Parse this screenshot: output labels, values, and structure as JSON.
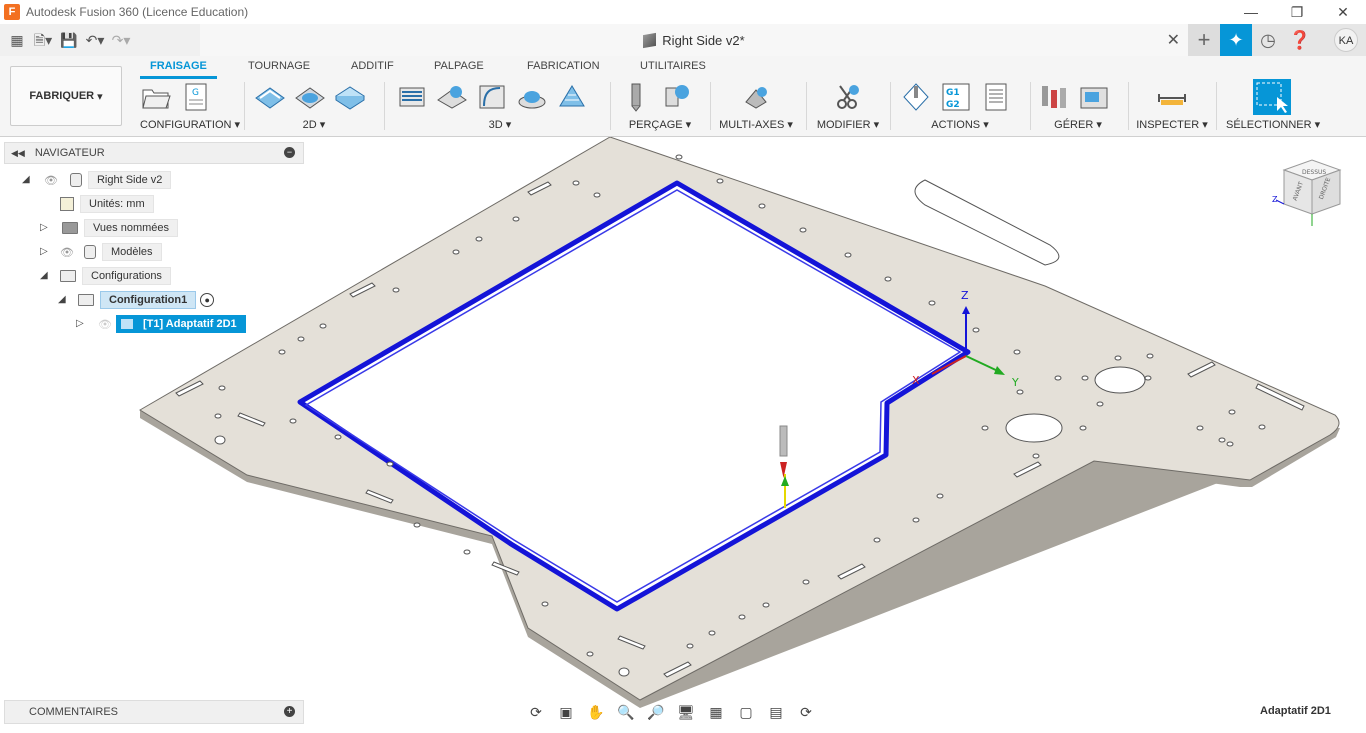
{
  "window": {
    "title": "Autodesk Fusion 360 (Licence Education)",
    "app_icon_letter": "F"
  },
  "document": {
    "tab_title": "Right Side v2*"
  },
  "user": {
    "initials": "KA"
  },
  "workspace": {
    "label": "FABRIQUER"
  },
  "ribbon_tabs": [
    "FRAISAGE",
    "TOURNAGE",
    "ADDITIF",
    "PALPAGE",
    "FABRICATION",
    "UTILITAIRES"
  ],
  "ribbon_groups": {
    "configuration": "CONFIGURATION",
    "g2d": "2D",
    "g3d": "3D",
    "percage": "PERÇAGE",
    "multiaxes": "MULTI-AXES",
    "modifier": "MODIFIER",
    "actions": "ACTIONS",
    "gerer": "GÉRER",
    "inspecter": "INSPECTER",
    "selectionner": "SÉLECTIONNER"
  },
  "navigator": {
    "title": "NAVIGATEUR",
    "root": "Right Side v2",
    "units": "Unités: mm",
    "named_views": "Vues nommées",
    "models": "Modèles",
    "setups": "Configurations",
    "setup1": "Configuration1",
    "operation": "[T1] Adaptatif 2D1"
  },
  "comments": {
    "title": "COMMENTAIRES"
  },
  "status": {
    "current_operation": "Adaptatif 2D1"
  },
  "viewcube": {
    "face_top": "DESSUS",
    "face_front": "AVANT",
    "face_right": "DROITE"
  },
  "axes": {
    "x": "X",
    "y": "Y",
    "z": "Z"
  },
  "colors": {
    "accent": "#0696d7",
    "toolpath": "#1414d8",
    "part": "#e4e0d8"
  }
}
